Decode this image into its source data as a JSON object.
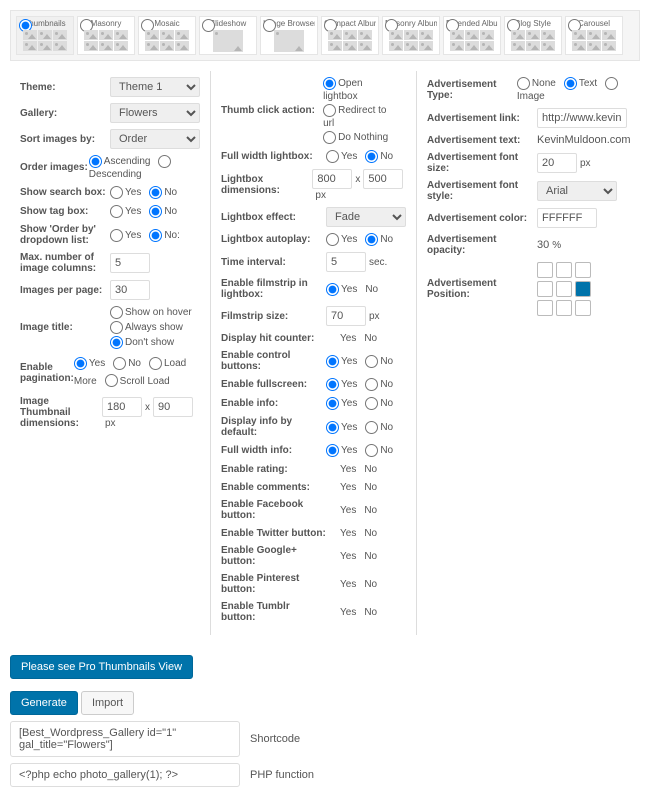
{
  "tiles": [
    {
      "label": "Thumbnails",
      "sel": true
    },
    {
      "label": "Masonry",
      "sel": false
    },
    {
      "label": "Mosaic",
      "sel": false
    },
    {
      "label": "Slideshow",
      "sel": false
    },
    {
      "label": "Image Browser",
      "sel": false
    },
    {
      "label": "Compact Album",
      "sel": false
    },
    {
      "label": "Masonry Album",
      "sel": false
    },
    {
      "label": "Extended Album",
      "sel": false
    },
    {
      "label": "Blog Style",
      "sel": false
    },
    {
      "label": "Carousel",
      "sel": false
    }
  ],
  "c1": {
    "theme_lbl": "Theme:",
    "theme_val": "Theme 1",
    "gallery_lbl": "Gallery:",
    "gallery_val": "Flowers",
    "sort_lbl": "Sort images by:",
    "sort_val": "Order",
    "order_lbl": "Order images:",
    "asc": "Ascending",
    "desc": "Descending",
    "search_lbl": "Show search box:",
    "tag_lbl": "Show tag box:",
    "orderby_lbl": "Show 'Order by' dropdown list:",
    "maxcol_lbl": "Max. number of image columns:",
    "maxcol_val": "5",
    "perpage_lbl": "Images per page:",
    "perpage_val": "30",
    "title_lbl": "Image title:",
    "t_hover": "Show on hover",
    "t_always": "Always show",
    "t_dont": "Don't show",
    "pag_lbl": "Enable pagination:",
    "pag_loadmore": "Load More",
    "pag_scroll": "Scroll Load",
    "thdim_lbl": "Image Thumbnail dimensions:",
    "thdim_w": "180",
    "thdim_h": "90",
    "px": "px",
    "x": "x",
    "yes": "Yes",
    "no": "No",
    "nocolon": "No:"
  },
  "c2": {
    "click_lbl": "Thumb click action:",
    "open": "Open lightbox",
    "redir": "Redirect to url",
    "donoth": "Do Nothing",
    "fwl_lbl": "Full width lightbox:",
    "ldim_lbl": "Lightbox dimensions:",
    "ldim_w": "800",
    "ldim_h": "500",
    "px": "px",
    "x": "x",
    "effect_lbl": "Lightbox effect:",
    "effect_val": "Fade",
    "auto_lbl": "Lightbox autoplay:",
    "int_lbl": "Time interval:",
    "int_val": "5",
    "sec": "sec.",
    "film_lbl": "Enable filmstrip in lightbox:",
    "fsize_lbl": "Filmstrip size:",
    "fsize_val": "70",
    "hit_lbl": "Display hit counter:",
    "ctrl_lbl": "Enable control buttons:",
    "fs_lbl": "Enable fullscreen:",
    "info_lbl": "Enable info:",
    "infodef_lbl": "Display info by default:",
    "fwi_lbl": "Full width info:",
    "rate_lbl": "Enable rating:",
    "comm_lbl": "Enable comments:",
    "fb_lbl": "Enable Facebook button:",
    "tw_lbl": "Enable Twitter button:",
    "gp_lbl": "Enable Google+ button:",
    "pin_lbl": "Enable Pinterest button:",
    "tb_lbl": "Enable Tumblr button:",
    "yes": "Yes",
    "no": "No"
  },
  "c3": {
    "type_lbl": "Advertisement Type:",
    "none": "None",
    "text": "Text",
    "image": "Image",
    "link_lbl": "Advertisement link:",
    "link_val": "http://www.kevinmuld",
    "txt_lbl": "Advertisement text:",
    "txt_val": "KevinMuldoon.com",
    "size_lbl": "Advertisement font size:",
    "size_val": "20",
    "px": "px",
    "style_lbl": "Advertisement font style:",
    "style_val": "Arial",
    "color_lbl": "Advertisement color:",
    "color_val": "FFFFFF",
    "opac_lbl": "Advertisement opacity:",
    "opac_val": "30",
    "pct": "%",
    "pos_lbl": "Advertisement Position:"
  },
  "footer": {
    "pro": "Please see Pro Thumbnails View",
    "gen": "Generate",
    "imp": "Import",
    "sc_val": "[Best_Wordpress_Gallery id=\"1\" gal_title=\"Flowers\"]",
    "sc_lbl": "Shortcode",
    "php_val": "<?php echo photo_gallery(1); ?>",
    "php_lbl": "PHP function"
  }
}
